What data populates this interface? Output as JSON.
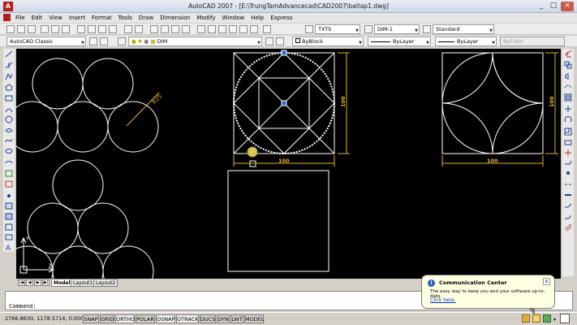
{
  "app": {
    "title": "AutoCAD 2007 - [E:\\TrungTamAdvancecad\\CAD2007\\baitap1.dwg]",
    "window_controls": [
      "_",
      "□",
      "×"
    ]
  },
  "menu": [
    "File",
    "Edit",
    "View",
    "Insert",
    "Format",
    "Tools",
    "Draw",
    "Dimension",
    "Modify",
    "Window",
    "Help",
    "Express"
  ],
  "toolbar2": {
    "text_style": "TXTS",
    "dim_style": "DIM-1",
    "table_style": "Standard"
  },
  "toolbar3": {
    "workspace": "AutoCAD Classic",
    "layer": "DIM",
    "color": "ByBlock",
    "linetype": "ByLayer",
    "lineweight": "ByLayer",
    "plotstyle": "ByColor"
  },
  "drawing": {
    "radius_label": "R25",
    "dim_100_labels": [
      "100",
      "100",
      "100",
      "100"
    ],
    "ucs_x": "X",
    "ucs_y": "Y"
  },
  "layout_tabs": {
    "nav": [
      "|◀",
      "◀",
      "▶",
      "▶|"
    ],
    "tabs": [
      "Model",
      "Layout1",
      "Layout2"
    ]
  },
  "command": {
    "prompt": "Command:"
  },
  "status": {
    "coords": "2766.8630, 1178.5714, 0.0000",
    "toggles": [
      "SNAP",
      "GRID",
      "ORTHO",
      "POLAR",
      "OSNAP",
      "OTRACK",
      "DUCS",
      "DYN",
      "LWT",
      "MODEL"
    ]
  },
  "balloon": {
    "title": "Communication Center",
    "body": "The easy way to keep you and your software up-to-date.",
    "link": "Click here.",
    "close": "x",
    "info": "i"
  },
  "colors": {
    "canvas": "#000000",
    "geometry": "#ffffff",
    "dimension": "#e0b23c"
  }
}
